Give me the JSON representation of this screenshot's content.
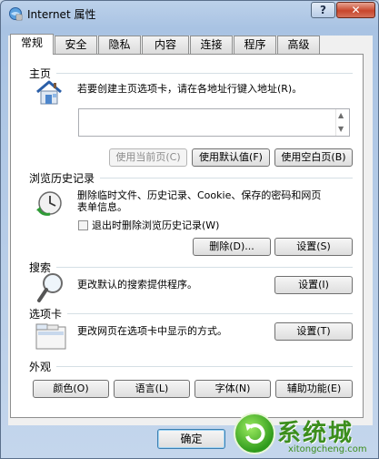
{
  "window": {
    "title": "Internet 属性",
    "help_label": "?",
    "close_label": "✕"
  },
  "tabs": [
    {
      "label": "常规",
      "active": true
    },
    {
      "label": "安全",
      "active": false
    },
    {
      "label": "隐私",
      "active": false
    },
    {
      "label": "内容",
      "active": false
    },
    {
      "label": "连接",
      "active": false
    },
    {
      "label": "程序",
      "active": false
    },
    {
      "label": "高级",
      "active": false
    }
  ],
  "home": {
    "section_label": "主页",
    "description": "若要创建主页选项卡，请在各地址行键入地址(R)。",
    "address_value": "",
    "btn_use_current": "使用当前页(C)",
    "btn_use_default": "使用默认值(F)",
    "btn_use_blank": "使用空白页(B)"
  },
  "history": {
    "section_label": "浏览历史记录",
    "description_line1": "删除临时文件、历史记录、Cookie、保存的密码和网页",
    "description_line2": "表单信息。",
    "checkbox_label": "退出时删除浏览历史记录(W)",
    "checkbox_checked": false,
    "btn_delete": "删除(D)...",
    "btn_settings": "设置(S)"
  },
  "search": {
    "section_label": "搜索",
    "description": "更改默认的搜索提供程序。",
    "btn_settings": "设置(I)"
  },
  "tabsec": {
    "section_label": "选项卡",
    "description": "更改网页在选项卡中显示的方式。",
    "btn_settings": "设置(T)"
  },
  "appearance": {
    "section_label": "外观",
    "btn_colors": "颜色(O)",
    "btn_languages": "语言(L)",
    "btn_fonts": "字体(N)",
    "btn_accessibility": "辅助功能(E)"
  },
  "footer": {
    "btn_ok": "确定"
  },
  "watermark": {
    "text": "系统城",
    "url": "xitongcheng.com"
  }
}
